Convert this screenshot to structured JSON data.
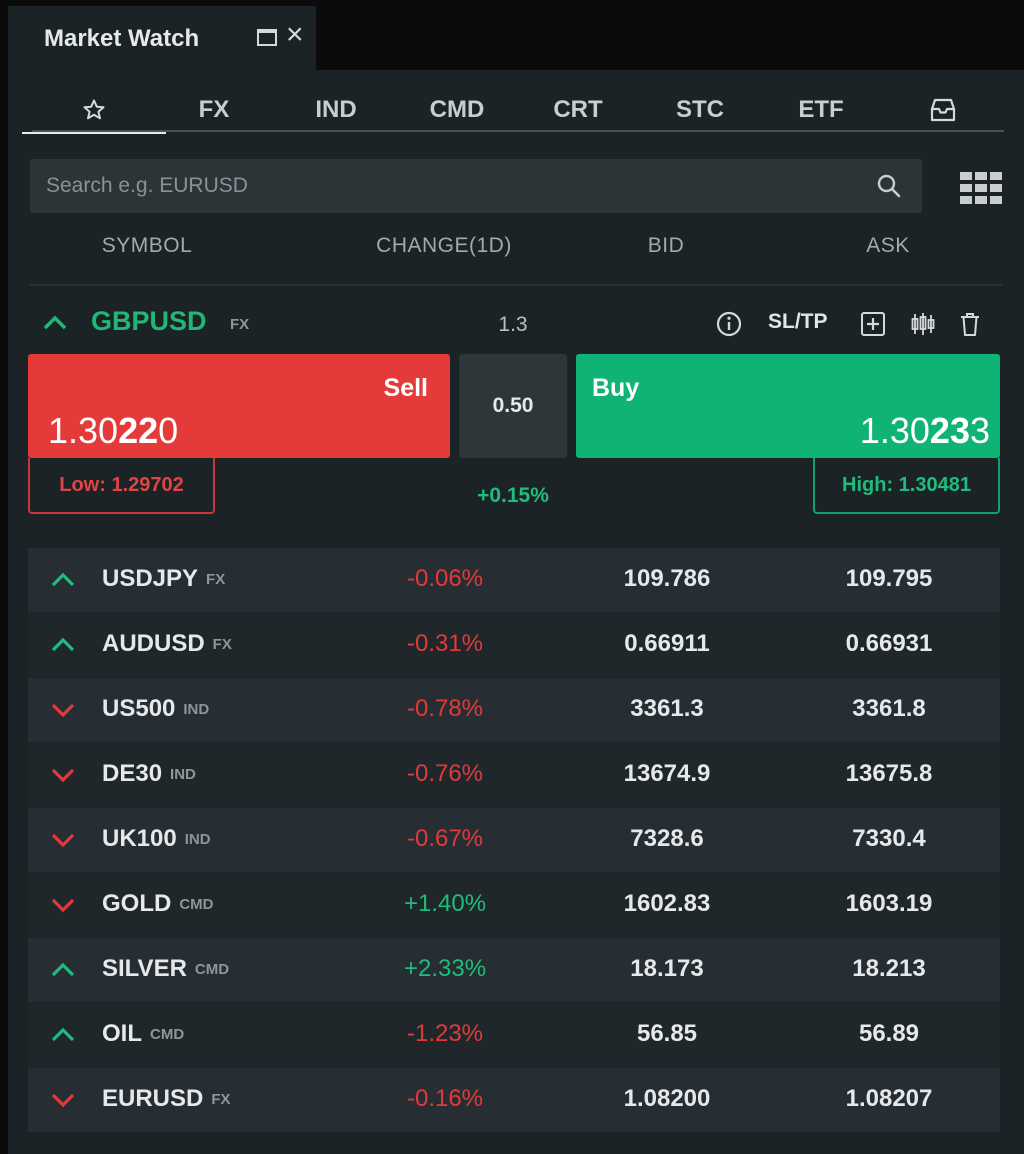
{
  "window": {
    "title": "Market Watch"
  },
  "tabs": [
    {
      "label": "",
      "icon": "star-icon"
    },
    {
      "label": "FX"
    },
    {
      "label": "IND"
    },
    {
      "label": "CMD"
    },
    {
      "label": "CRT"
    },
    {
      "label": "STC"
    },
    {
      "label": "ETF"
    },
    {
      "label": "",
      "icon": "inbox-icon"
    }
  ],
  "active_tab": "favorites",
  "search": {
    "placeholder": "Search e.g. EURUSD",
    "value": ""
  },
  "columns": {
    "symbol": "SYMBOL",
    "change": "CHANGE(1D)",
    "bid": "BID",
    "ask": "ASK"
  },
  "expanded": {
    "symbol": "GBPUSD",
    "type": "FX",
    "spread_value": "1.3",
    "sltp_label": "SL/TP",
    "sell_label": "Sell",
    "sell_price_pre": "1.30",
    "sell_price_big": "22",
    "sell_price_post": "0",
    "buy_label": "Buy",
    "buy_price_pre": "1.30",
    "buy_price_big": "23",
    "buy_price_post": "3",
    "volume": "0.50",
    "low": "Low: 1.29702",
    "high": "High: 1.30481",
    "change": "+0.15%",
    "colors": {
      "sell": "#e43a3a",
      "buy": "#0fb374",
      "up": "#1fbc7c",
      "down": "#e23a3a"
    }
  },
  "rows": [
    {
      "dir": "up",
      "symbol": "USDJPY",
      "type": "FX",
      "change": "-0.06%",
      "sign": "neg",
      "bid": "109.786",
      "ask": "109.795"
    },
    {
      "dir": "up",
      "symbol": "AUDUSD",
      "type": "FX",
      "change": "-0.31%",
      "sign": "neg",
      "bid": "0.66911",
      "ask": "0.66931"
    },
    {
      "dir": "down",
      "symbol": "US500",
      "type": "IND",
      "change": "-0.78%",
      "sign": "neg",
      "bid": "3361.3",
      "ask": "3361.8"
    },
    {
      "dir": "down",
      "symbol": "DE30",
      "type": "IND",
      "change": "-0.76%",
      "sign": "neg",
      "bid": "13674.9",
      "ask": "13675.8"
    },
    {
      "dir": "down",
      "symbol": "UK100",
      "type": "IND",
      "change": "-0.67%",
      "sign": "neg",
      "bid": "7328.6",
      "ask": "7330.4"
    },
    {
      "dir": "down",
      "symbol": "GOLD",
      "type": "CMD",
      "change": "+1.40%",
      "sign": "pos",
      "bid": "1602.83",
      "ask": "1603.19"
    },
    {
      "dir": "up",
      "symbol": "SILVER",
      "type": "CMD",
      "change": "+2.33%",
      "sign": "pos",
      "bid": "18.173",
      "ask": "18.213"
    },
    {
      "dir": "up",
      "symbol": "OIL",
      "type": "CMD",
      "change": "-1.23%",
      "sign": "neg",
      "bid": "56.85",
      "ask": "56.89"
    },
    {
      "dir": "down",
      "symbol": "EURUSD",
      "type": "FX",
      "change": "-0.16%",
      "sign": "neg",
      "bid": "1.08200",
      "ask": "1.08207"
    }
  ]
}
